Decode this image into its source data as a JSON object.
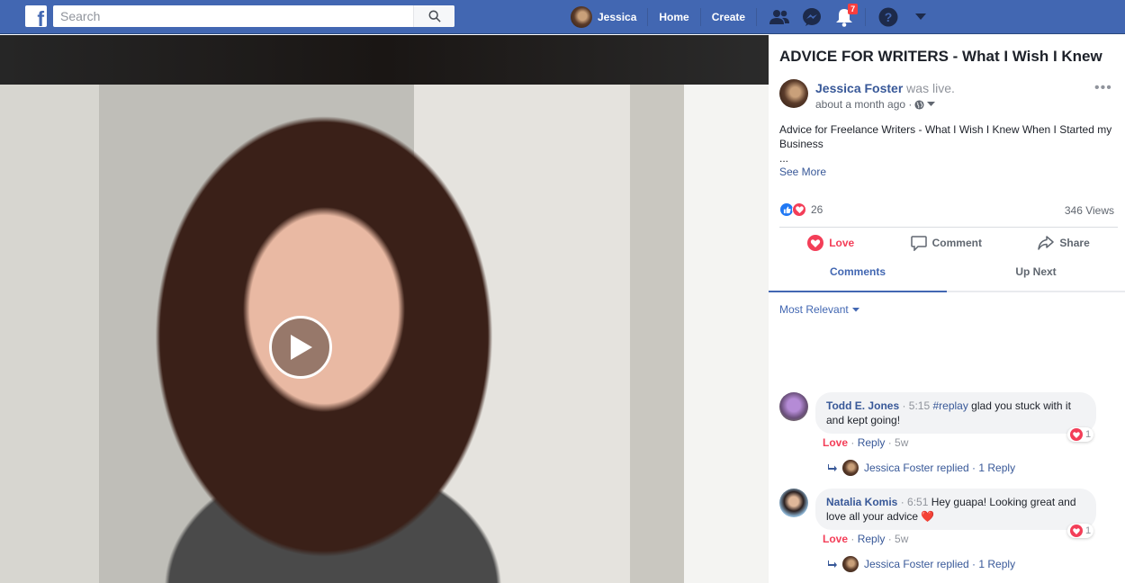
{
  "topbar": {
    "logo": "f",
    "search_placeholder": "Search",
    "user_name": "Jessica",
    "nav_home": "Home",
    "nav_create": "Create",
    "notifications_count": "7",
    "icons": [
      "friends-icon",
      "messenger-icon",
      "notifications-icon",
      "help-icon",
      "account-menu-icon"
    ]
  },
  "video": {
    "state": "paused"
  },
  "post": {
    "title": "ADVICE FOR WRITERS - What I Wish I Knew",
    "author": "Jessica Foster",
    "status": " was live.",
    "time": "about a month ago ·",
    "description": "Advice for Freelance Writers - What I Wish I Knew When I Started my Business",
    "ellipsis": "...",
    "see_more": "See More",
    "more_options": "•••",
    "reaction_count": "26",
    "views": "346 Views"
  },
  "actions": {
    "love": "Love",
    "comment": "Comment",
    "share": "Share"
  },
  "tabs": {
    "comments": "Comments",
    "up_next": "Up Next"
  },
  "sort": {
    "label": "Most Relevant"
  },
  "comments": [
    {
      "name": "Todd E. Jones",
      "time": " · 5:15 ",
      "tag": "#replay",
      "text": " glad you stuck with it and kept going!",
      "reaction": "Love",
      "reply": "Reply",
      "age": "5w",
      "reactions_count": "1",
      "reply_summary": "Jessica Foster replied · 1 Reply"
    },
    {
      "name": "Natalia Komis",
      "time": " · 6:51 ",
      "tag": "",
      "text": "Hey guapa! Looking great and love all your advice ❤️",
      "reaction": "Love",
      "reply": "Reply",
      "age": "5w",
      "reactions_count": "1",
      "reply_summary": "Jessica Foster replied · 1 Reply"
    }
  ],
  "colors": {
    "brand": "#4267b2",
    "link": "#385898",
    "love": "#f33e58",
    "like": "#2078f4",
    "badge": "#fa3e3e"
  }
}
